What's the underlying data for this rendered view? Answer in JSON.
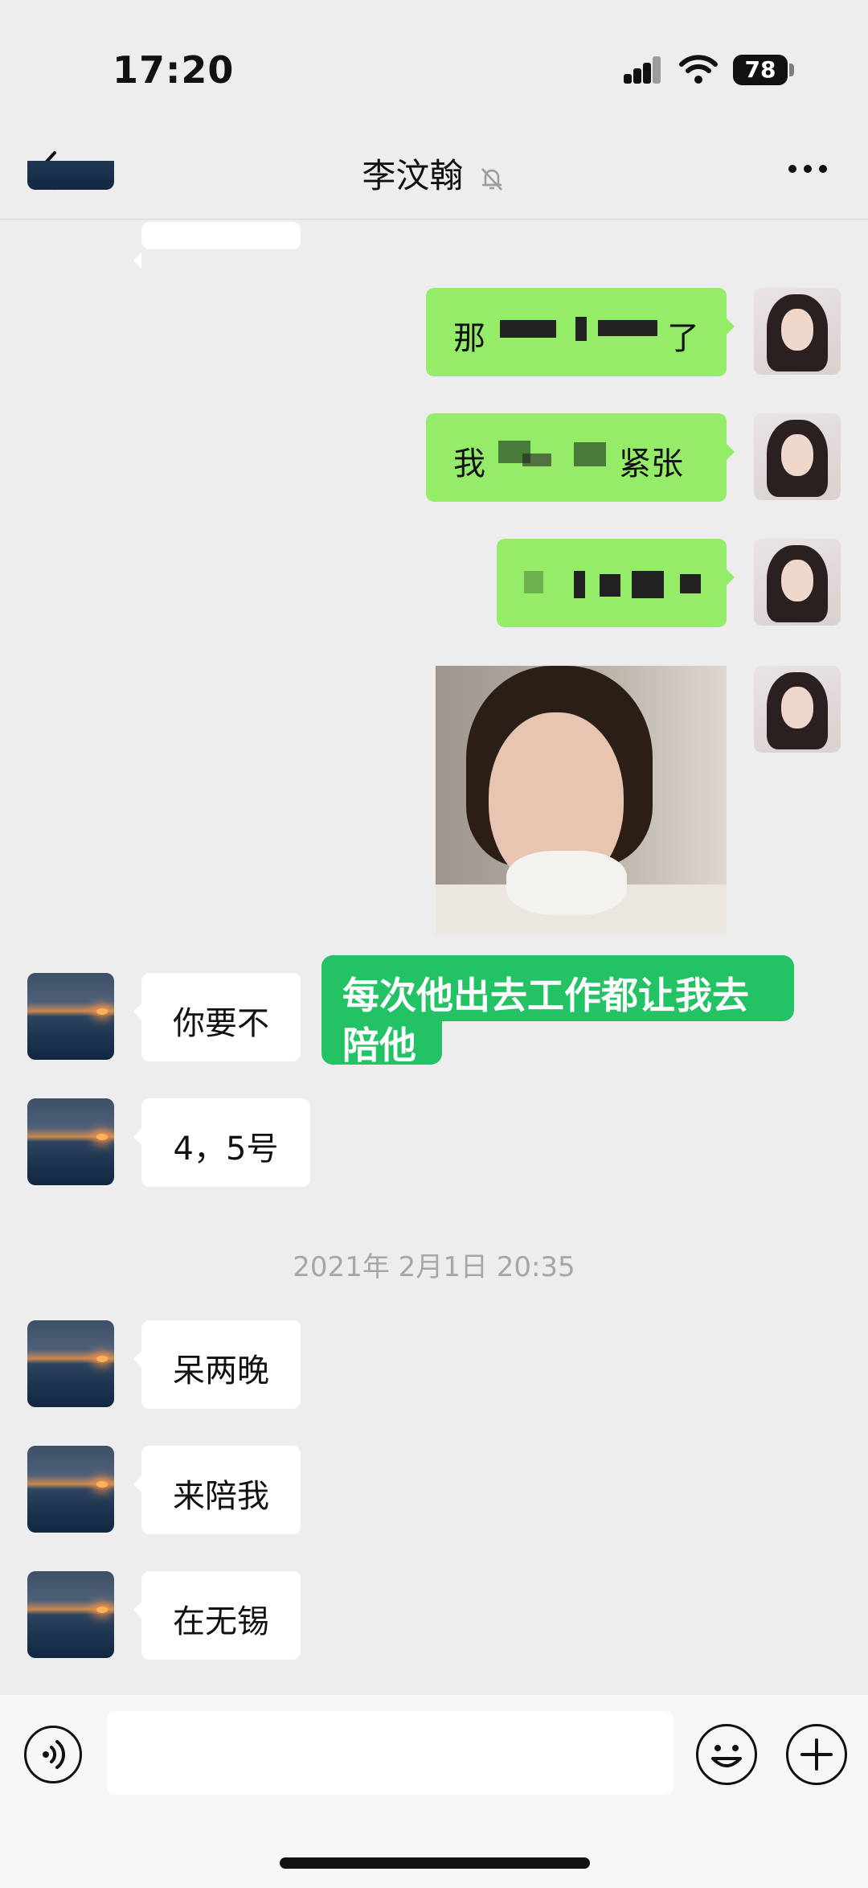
{
  "status_bar": {
    "time": "17:20",
    "battery": "78"
  },
  "nav": {
    "title": "李汶翰",
    "back_icon": "chevron-left-icon",
    "mute_icon": "bell-off-icon",
    "more_icon": "more-dots-icon"
  },
  "messages": {
    "out_1": "那",
    "out_1_end": "了",
    "out_2": "我",
    "out_2_end": "紧张",
    "in_1": "你要不",
    "in_2": "4，5号",
    "timestamp": "2021年 2月1日 20:35",
    "in_3": "呆两晚",
    "in_4": "来陪我",
    "in_5": "在无锡"
  },
  "overlay_caption": {
    "line1": "每次他出去工作都让我去",
    "line2": "陪他"
  },
  "input_bar": {
    "voice_icon": "voice-icon",
    "emoji_icon": "emoji-icon",
    "plus_icon": "plus-icon",
    "placeholder": ""
  },
  "colors": {
    "bg": "#ededed",
    "bubble_out": "#95ec69",
    "bubble_in": "#ffffff",
    "caption": "#23c265"
  }
}
